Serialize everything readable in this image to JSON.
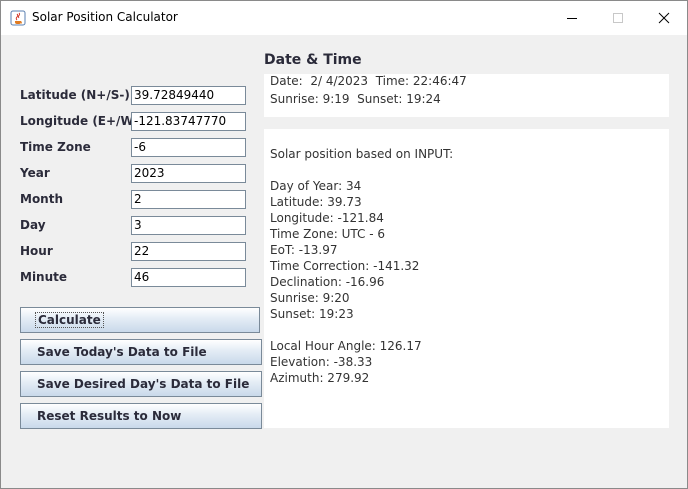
{
  "window": {
    "title": "Solar Position Calculator",
    "icon": "java-cup-icon"
  },
  "inputs": [
    {
      "label": "Latitude (N+/S-)",
      "value": "39.72849440"
    },
    {
      "label": "Longitude (E+/W-)",
      "value": "-121.83747770"
    },
    {
      "label": "Time Zone",
      "value": "-6"
    },
    {
      "label": "Year",
      "value": "2023"
    },
    {
      "label": "Month",
      "value": "2"
    },
    {
      "label": "Day",
      "value": "3"
    },
    {
      "label": "Hour",
      "value": "22"
    },
    {
      "label": "Minute",
      "value": "46"
    }
  ],
  "buttons": {
    "calculate": "Calculate",
    "save_today": "Save Today's Data to File",
    "save_desired": "Save Desired Day's Data to File",
    "reset": "Reset Results to Now"
  },
  "datetime": {
    "heading": "Date & Time",
    "line1": "Date:  2/ 4/2023  Time: 22:46:47",
    "line2": "Sunrise: 9:19  Sunset: 19:24"
  },
  "results": {
    "header": "Solar position based on INPUT:",
    "lines": [
      "Day of Year: 34",
      "Latitude: 39.73",
      "Longitude: -121.84",
      "Time Zone: UTC - 6",
      "EoT: -13.97",
      "Time Correction: -141.32",
      "Declination: -16.96",
      "Sunrise: 9:20",
      "Sunset: 19:23"
    ],
    "lines2": [
      "Local Hour Angle: 126.17",
      "Elevation: -38.33",
      "Azimuth: 279.92"
    ]
  }
}
